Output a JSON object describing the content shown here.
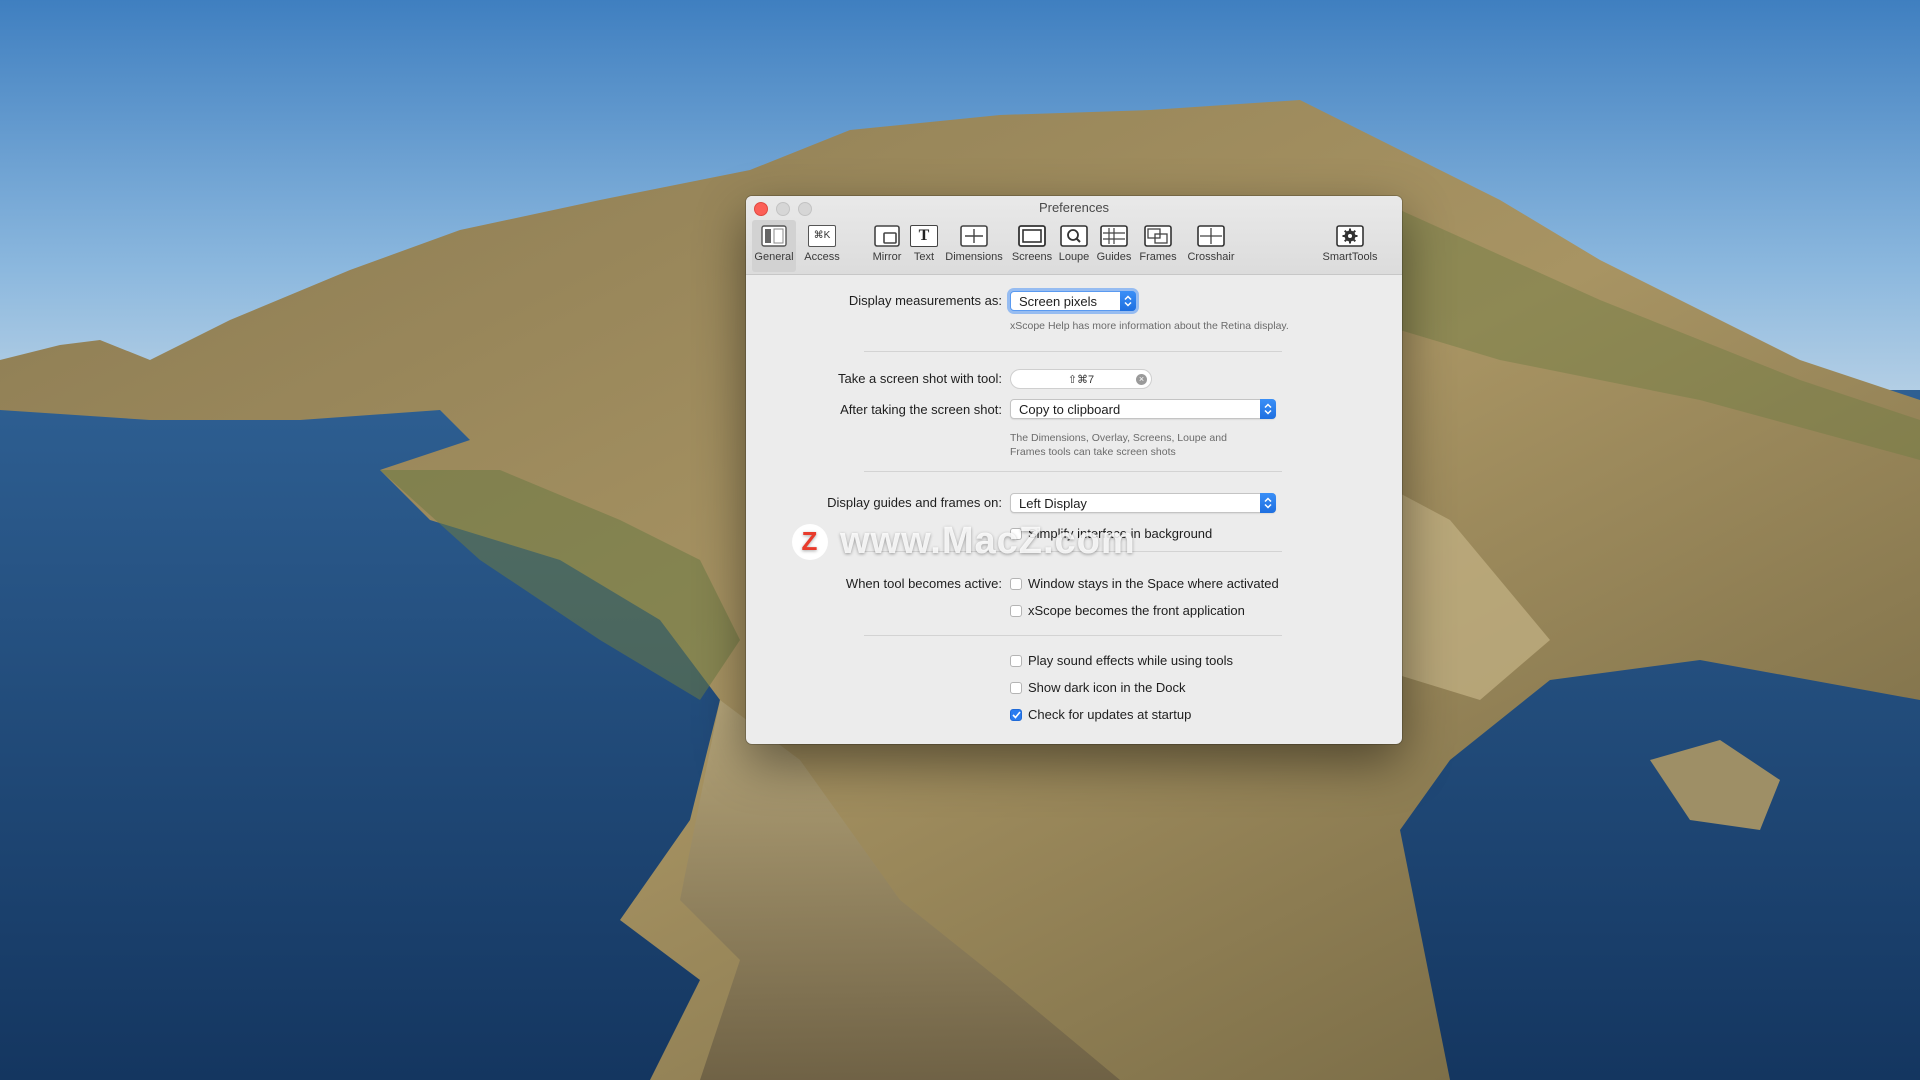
{
  "window": {
    "title": "Preferences"
  },
  "toolbar": {
    "items": [
      {
        "label": "General",
        "icon": "general-icon"
      },
      {
        "label": "Access",
        "icon": "access-icon",
        "glyph": "⌘K"
      },
      {
        "label": "Mirror",
        "icon": "mirror-icon"
      },
      {
        "label": "Text",
        "icon": "text-icon",
        "glyph": "T"
      },
      {
        "label": "Dimensions",
        "icon": "dimensions-icon"
      },
      {
        "label": "Screens",
        "icon": "screens-icon"
      },
      {
        "label": "Loupe",
        "icon": "loupe-icon"
      },
      {
        "label": "Guides",
        "icon": "guides-icon"
      },
      {
        "label": "Frames",
        "icon": "frames-icon"
      },
      {
        "label": "Crosshair",
        "icon": "crosshair-icon"
      },
      {
        "label": "SmartTools",
        "icon": "gear-icon"
      }
    ],
    "selected": "General"
  },
  "general": {
    "display_measurements_label": "Display measurements as:",
    "display_measurements_value": "Screen pixels",
    "retina_help": "xScope Help has more information about the Retina display.",
    "screenshot_tool_label": "Take a screen shot with tool:",
    "screenshot_shortcut": "⇧⌘7",
    "after_screenshot_label": "After taking the screen shot:",
    "after_screenshot_value": "Copy to clipboard",
    "screenshot_help_line1": "The Dimensions, Overlay, Screens, Loupe and",
    "screenshot_help_line2": "Frames tools can take screen shots",
    "guides_display_label": "Display guides and frames on:",
    "guides_display_value": "Left Display",
    "simplify_label": "Simplify interface in background",
    "tool_active_label": "When tool becomes active:",
    "window_stays_label": "Window stays in the Space where activated",
    "front_app_label": "xScope becomes the front application",
    "play_sound_label": "Play sound effects while using tools",
    "dark_icon_label": "Show dark icon in the Dock",
    "check_updates_label": "Check for updates at startup"
  },
  "checkboxes": {
    "simplify": false,
    "window_stays": false,
    "front_app": false,
    "play_sound": false,
    "dark_icon": false,
    "check_updates": true
  },
  "watermark": {
    "logo_letter": "Z",
    "text": "www.MacZ.com"
  },
  "colors": {
    "accent": "#2a7cf0",
    "close": "#fc5f57"
  }
}
